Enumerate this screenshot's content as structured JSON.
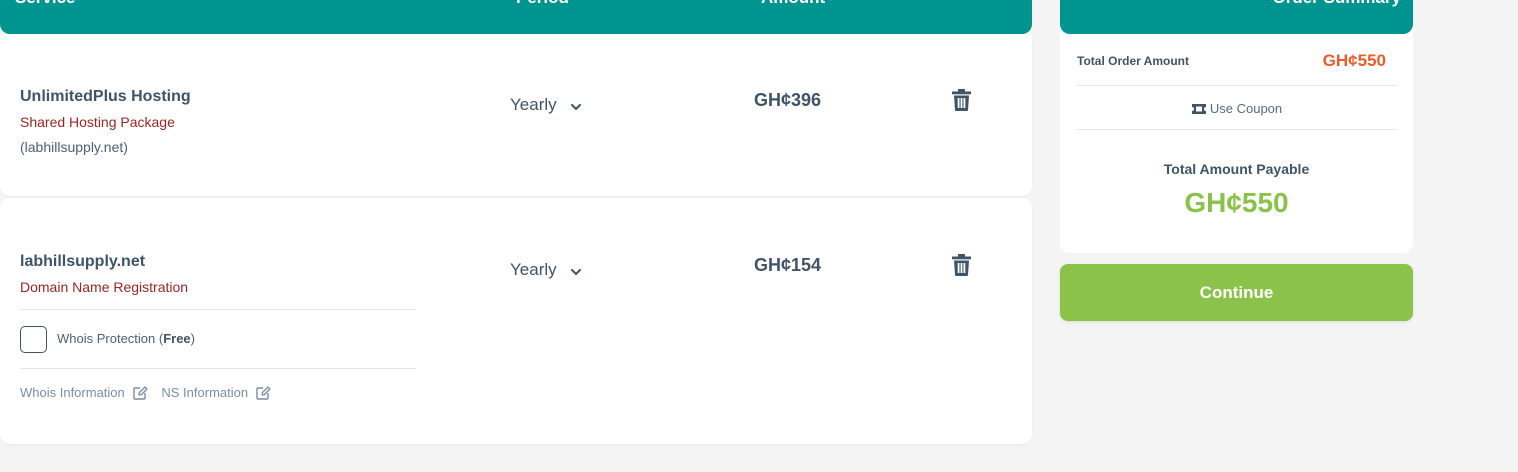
{
  "table_header": {
    "service": "Service",
    "period": "Period",
    "amount": "Amount"
  },
  "items": [
    {
      "name": "UnlimitedPlus Hosting",
      "subtitle": "Shared Hosting Package",
      "domain": "(labhillsupply.net)",
      "period": "Yearly",
      "amount": "GH¢396"
    },
    {
      "name": "labhillsupply.net",
      "subtitle": "Domain Name Registration",
      "period": "Yearly",
      "amount": "GH¢154",
      "whois_protection_prefix": "Whois Protection (",
      "whois_protection_free": "Free",
      "whois_protection_suffix": ")",
      "whois_information": "Whois Information",
      "ns_information": "NS Information"
    }
  ],
  "summary": {
    "title": "Order Summary",
    "total_order_amount_label": "Total Order Amount",
    "total_order_amount": "GH¢550",
    "coupon_label": "Use Coupon",
    "total_payable_label": "Total Amount Payable",
    "total_payable": "GH¢550",
    "continue_label": "Continue"
  },
  "colors": {
    "header_bg": "#009490",
    "accent_green": "#8bc34a",
    "accent_orange": "#ef5b2b",
    "subtitle_red": "#9d2525",
    "text_dark": "#3f5468"
  },
  "icons": {
    "period_dropdown": "chevron-down-icon",
    "remove": "trash-icon",
    "edit": "edit-icon",
    "coupon": "ticket-icon"
  }
}
